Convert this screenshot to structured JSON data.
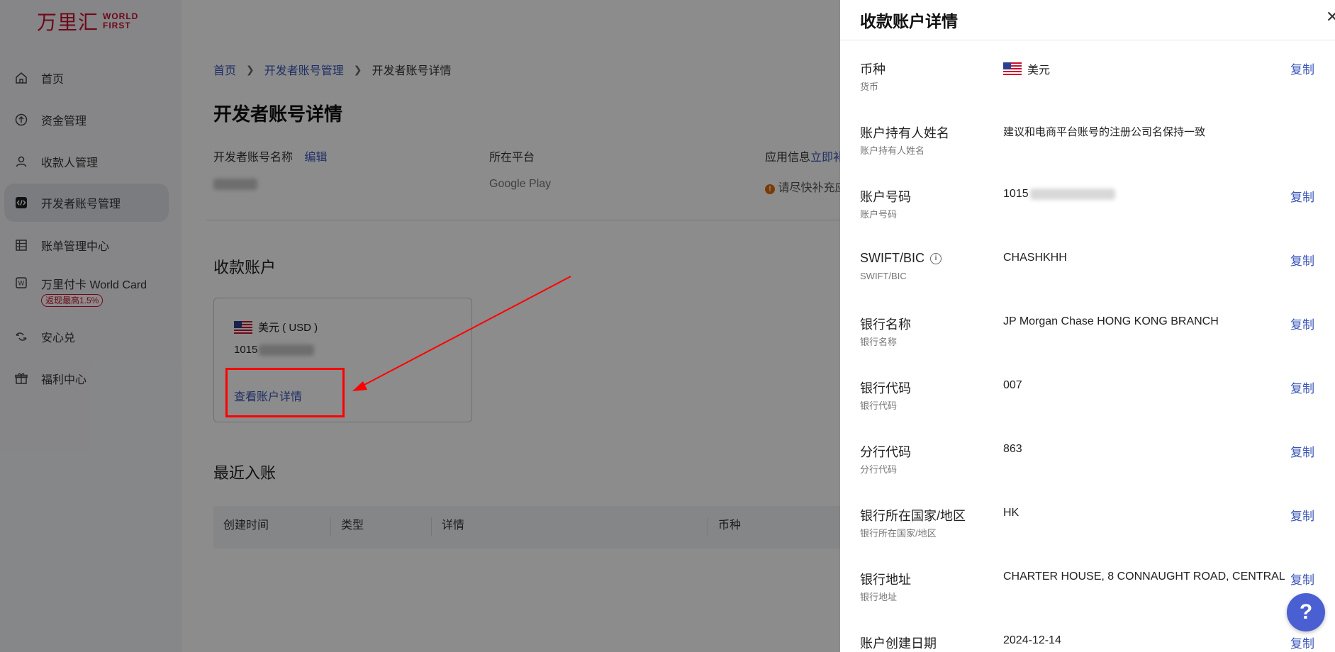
{
  "brand": {
    "cn": "万里汇",
    "en_line1": "WORLD",
    "en_line2": "FIRST",
    "color": "#c8102e"
  },
  "sidebar": {
    "items": [
      {
        "label": "首页",
        "icon": "home-icon"
      },
      {
        "label": "资金管理",
        "icon": "funds-icon"
      },
      {
        "label": "收款人管理",
        "icon": "user-icon"
      },
      {
        "label": "开发者账号管理",
        "icon": "code-icon",
        "active": true
      },
      {
        "label": "账单管理中心",
        "icon": "ledger-icon"
      },
      {
        "label": "万里付卡 World Card",
        "icon": "card-icon",
        "badge": "返现最高1.5%"
      },
      {
        "label": "安心兑",
        "icon": "exchange-icon"
      },
      {
        "label": "福利中心",
        "icon": "gift-icon"
      }
    ]
  },
  "breadcrumb": {
    "home": "首页",
    "parent": "开发者账号管理",
    "current": "开发者账号详情"
  },
  "page": {
    "title": "开发者账号详情",
    "account_name_label": "开发者账号名称",
    "edit_label": "编辑",
    "platform_label": "所在平台",
    "platform_value": "Google Play",
    "app_info_label": "应用信息",
    "app_info_link": "立即补",
    "app_info_warning": "请尽快补充应",
    "receiving_title": "收款账户",
    "card_currency": "美元 ( USD )",
    "card_number": "1015",
    "card_link": "查看账户详情",
    "recent_title": "最近入账",
    "table_headers": [
      "创建时间",
      "类型",
      "详情",
      "币种"
    ]
  },
  "drawer": {
    "title": "收款账户详情",
    "close_symbol": "✕",
    "copy_label": "复制",
    "rows": [
      {
        "label": "币种",
        "sub": "货币",
        "value": "美元",
        "flag": true,
        "copy": true
      },
      {
        "label": "账户持有人姓名",
        "sub": "账户持有人姓名",
        "value": "建议和电商平台账号的注册公司名保持一致",
        "copy": false
      },
      {
        "label": "账户号码",
        "sub": "账户号码",
        "value": "1015",
        "blurred": true,
        "copy": true
      },
      {
        "label": "SWIFT/BIC",
        "sub": "SWIFT/BIC",
        "value": "CHASHKHH",
        "info": true,
        "copy": true
      },
      {
        "label": "银行名称",
        "sub": "银行名称",
        "value": "JP Morgan Chase HONG KONG BRANCH",
        "copy": true
      },
      {
        "label": "银行代码",
        "sub": "银行代码",
        "value": "007",
        "copy": true
      },
      {
        "label": "分行代码",
        "sub": "分行代码",
        "value": "863",
        "copy": true
      },
      {
        "label": "银行所在国家/地区",
        "sub": "银行所在国家/地区",
        "value": "HK",
        "copy": true
      },
      {
        "label": "银行地址",
        "sub": "银行地址",
        "value": "CHARTER HOUSE, 8 CONNAUGHT ROAD, CENTRAL",
        "copy": true
      },
      {
        "label": "账户创建日期",
        "sub": "",
        "value": "2024-12-14",
        "copy": true
      }
    ]
  },
  "help": {
    "label": "?"
  },
  "colors": {
    "accent": "#3a55b8",
    "help": "#4a5fd1",
    "annotation": "#ff0000"
  }
}
